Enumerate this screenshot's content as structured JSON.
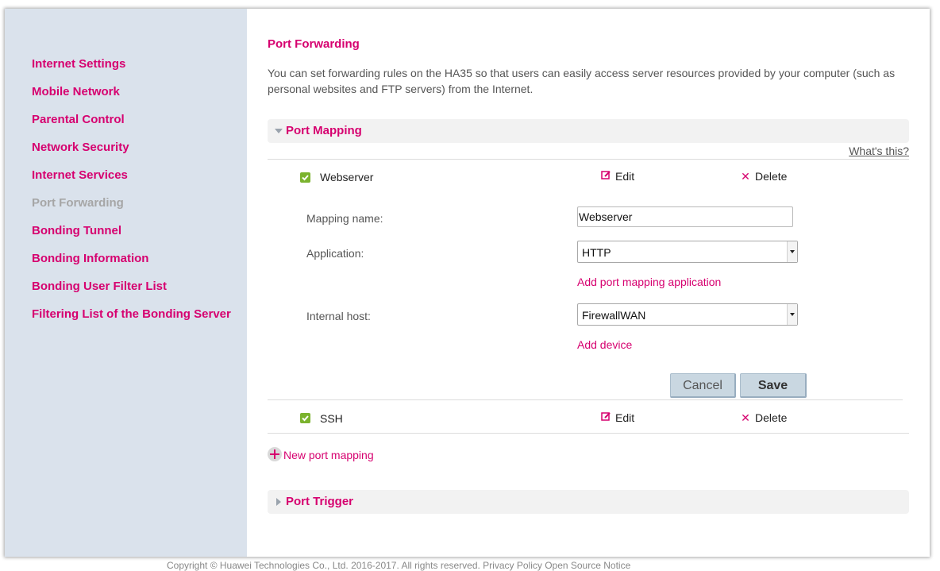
{
  "colors": {
    "accent": "#d6006f",
    "sidebar_bg": "#dae2ec",
    "active_nav": "#a6a6a6",
    "check": "#7bb32e"
  },
  "sidebar": {
    "items": [
      {
        "label": "Internet Settings"
      },
      {
        "label": "Mobile Network"
      },
      {
        "label": "Parental Control"
      },
      {
        "label": "Network Security"
      },
      {
        "label": "Internet Services"
      },
      {
        "label": "Port Forwarding",
        "active": true
      },
      {
        "label": "Bonding Tunnel"
      },
      {
        "label": "Bonding Information"
      },
      {
        "label": "Bonding User Filter List"
      },
      {
        "label": "Filtering List of the Bonding Server"
      }
    ]
  },
  "main": {
    "title": "Port Forwarding",
    "intro": "You can set forwarding rules on the HA35 so that users can easily access server resources provided by your computer (such as personal websites and FTP servers) from the Internet.",
    "port_mapping": {
      "heading": "Port Mapping",
      "whats_this": "What's this?",
      "rows": [
        {
          "name": "Webserver",
          "edit": "Edit",
          "delete": "Delete",
          "icon_edit": "edit-icon",
          "icon_delete": "delete-icon",
          "checked": true
        },
        {
          "name": "SSH",
          "edit": "Edit",
          "delete": "Delete",
          "icon_edit": "edit-icon",
          "icon_delete": "delete-icon",
          "checked": true
        }
      ],
      "form": {
        "mapping_name_label": "Mapping name:",
        "mapping_name_value": "Webserver",
        "application_label": "Application:",
        "application_value": "HTTP",
        "add_app_link": "Add port mapping application",
        "internal_host_label": "Internal host:",
        "internal_host_value": "FirewallWAN",
        "add_device_link": "Add device",
        "cancel": "Cancel",
        "save": "Save"
      },
      "new_mapping": "New port mapping"
    },
    "port_trigger": {
      "heading": "Port Trigger"
    }
  },
  "footer": {
    "text": "Copyright © Huawei Technologies Co., Ltd. 2016-2017. All rights reserved.    Privacy Policy    Open Source Notice"
  }
}
